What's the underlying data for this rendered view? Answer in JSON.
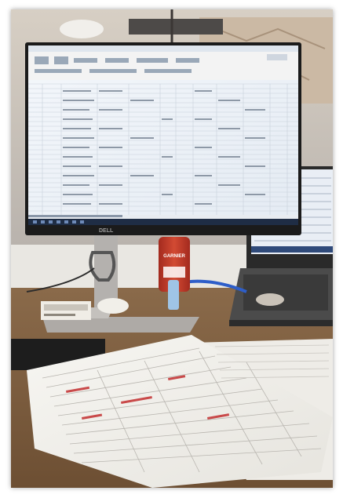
{
  "photo": {
    "monitor_brand": "DELL",
    "cream_tube_brand": "GARNIER"
  }
}
